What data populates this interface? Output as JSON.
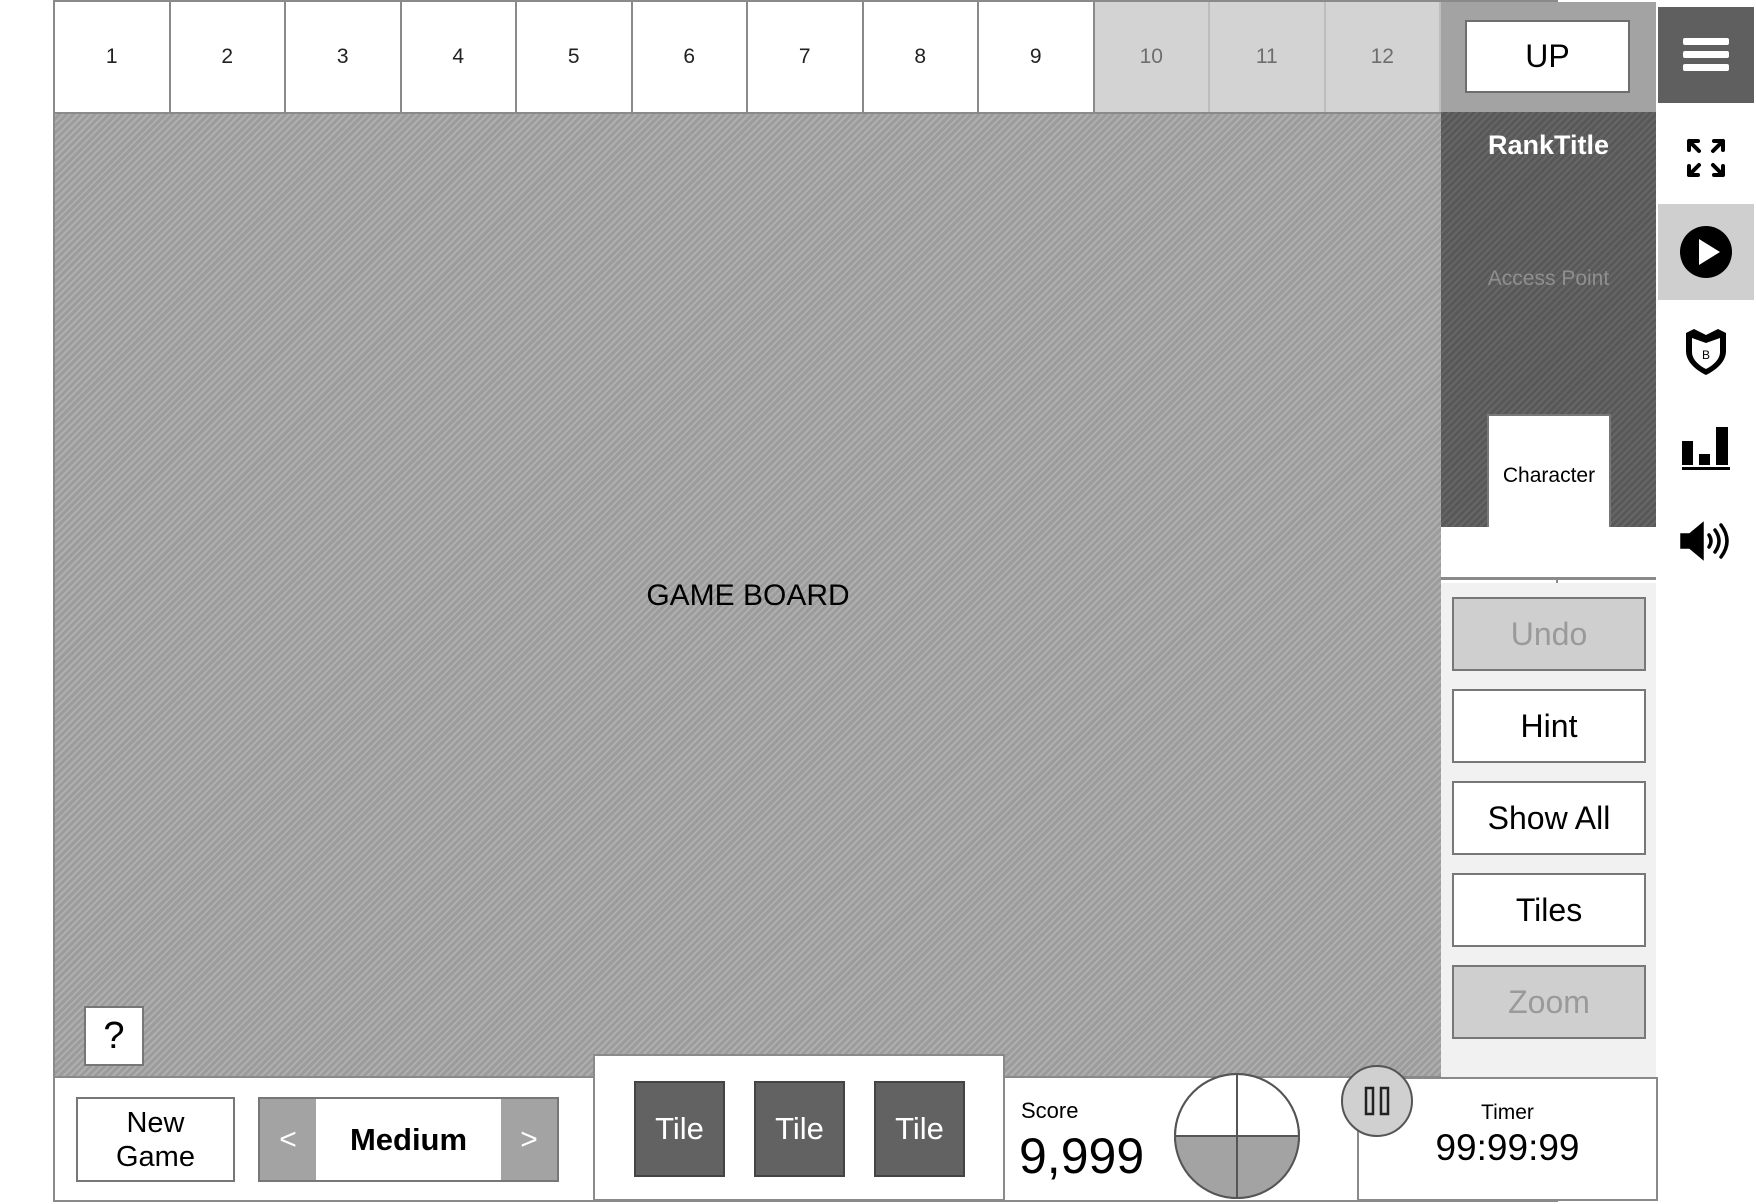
{
  "levels": {
    "items": [
      {
        "label": "1",
        "locked": false
      },
      {
        "label": "2",
        "locked": false
      },
      {
        "label": "3",
        "locked": false
      },
      {
        "label": "4",
        "locked": false
      },
      {
        "label": "5",
        "locked": false
      },
      {
        "label": "6",
        "locked": false
      },
      {
        "label": "7",
        "locked": false
      },
      {
        "label": "8",
        "locked": false
      },
      {
        "label": "9",
        "locked": false
      },
      {
        "label": "10",
        "locked": true
      },
      {
        "label": "11",
        "locked": true
      },
      {
        "label": "12",
        "locked": true
      }
    ],
    "up_label": "UP"
  },
  "board": {
    "label": "GAME BOARD",
    "help_label": "?"
  },
  "rank": {
    "title": "RankTitle",
    "access_point": "Access Point",
    "character": "Character"
  },
  "actions": {
    "undo": {
      "label": "Undo",
      "disabled": true
    },
    "hint": {
      "label": "Hint",
      "disabled": false
    },
    "show_all": {
      "label": "Show All",
      "disabled": false
    },
    "tiles": {
      "label": "Tiles",
      "disabled": false
    },
    "zoom": {
      "label": "Zoom",
      "disabled": true
    }
  },
  "sidebar_icons": [
    "menu-icon",
    "fullscreen-icon",
    "play-icon",
    "badge-shield-icon",
    "leaderboard-icon",
    "sound-icon"
  ],
  "badge_letter": "B",
  "bottom": {
    "new_game_line1": "New",
    "new_game_line2": "Game",
    "difficulty": {
      "prev": "<",
      "value": "Medium",
      "next": ">"
    },
    "tiles": [
      "Tile",
      "Tile",
      "Tile"
    ],
    "score_label": "Score",
    "score_value": "9,999",
    "progress_fraction": 0.5,
    "timer_label": "Timer",
    "timer_value": "99:99:99"
  },
  "colors": {
    "locked_level": "#d3d3d3",
    "dark_panel": "#5d5d5d",
    "tile": "#626262",
    "disabled_button": "#cfcfcf"
  }
}
